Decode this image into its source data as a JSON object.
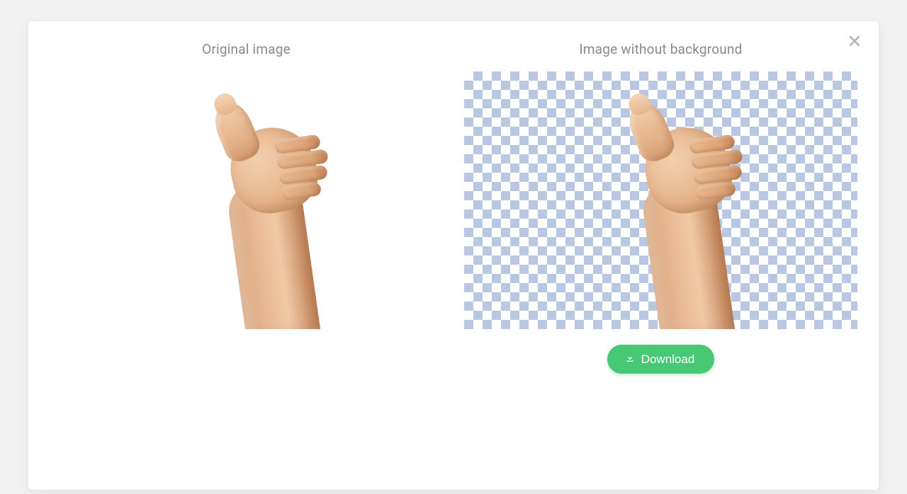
{
  "panels": {
    "original": {
      "title": "Original image"
    },
    "result": {
      "title": "Image without background"
    }
  },
  "actions": {
    "download_label": "Download"
  }
}
